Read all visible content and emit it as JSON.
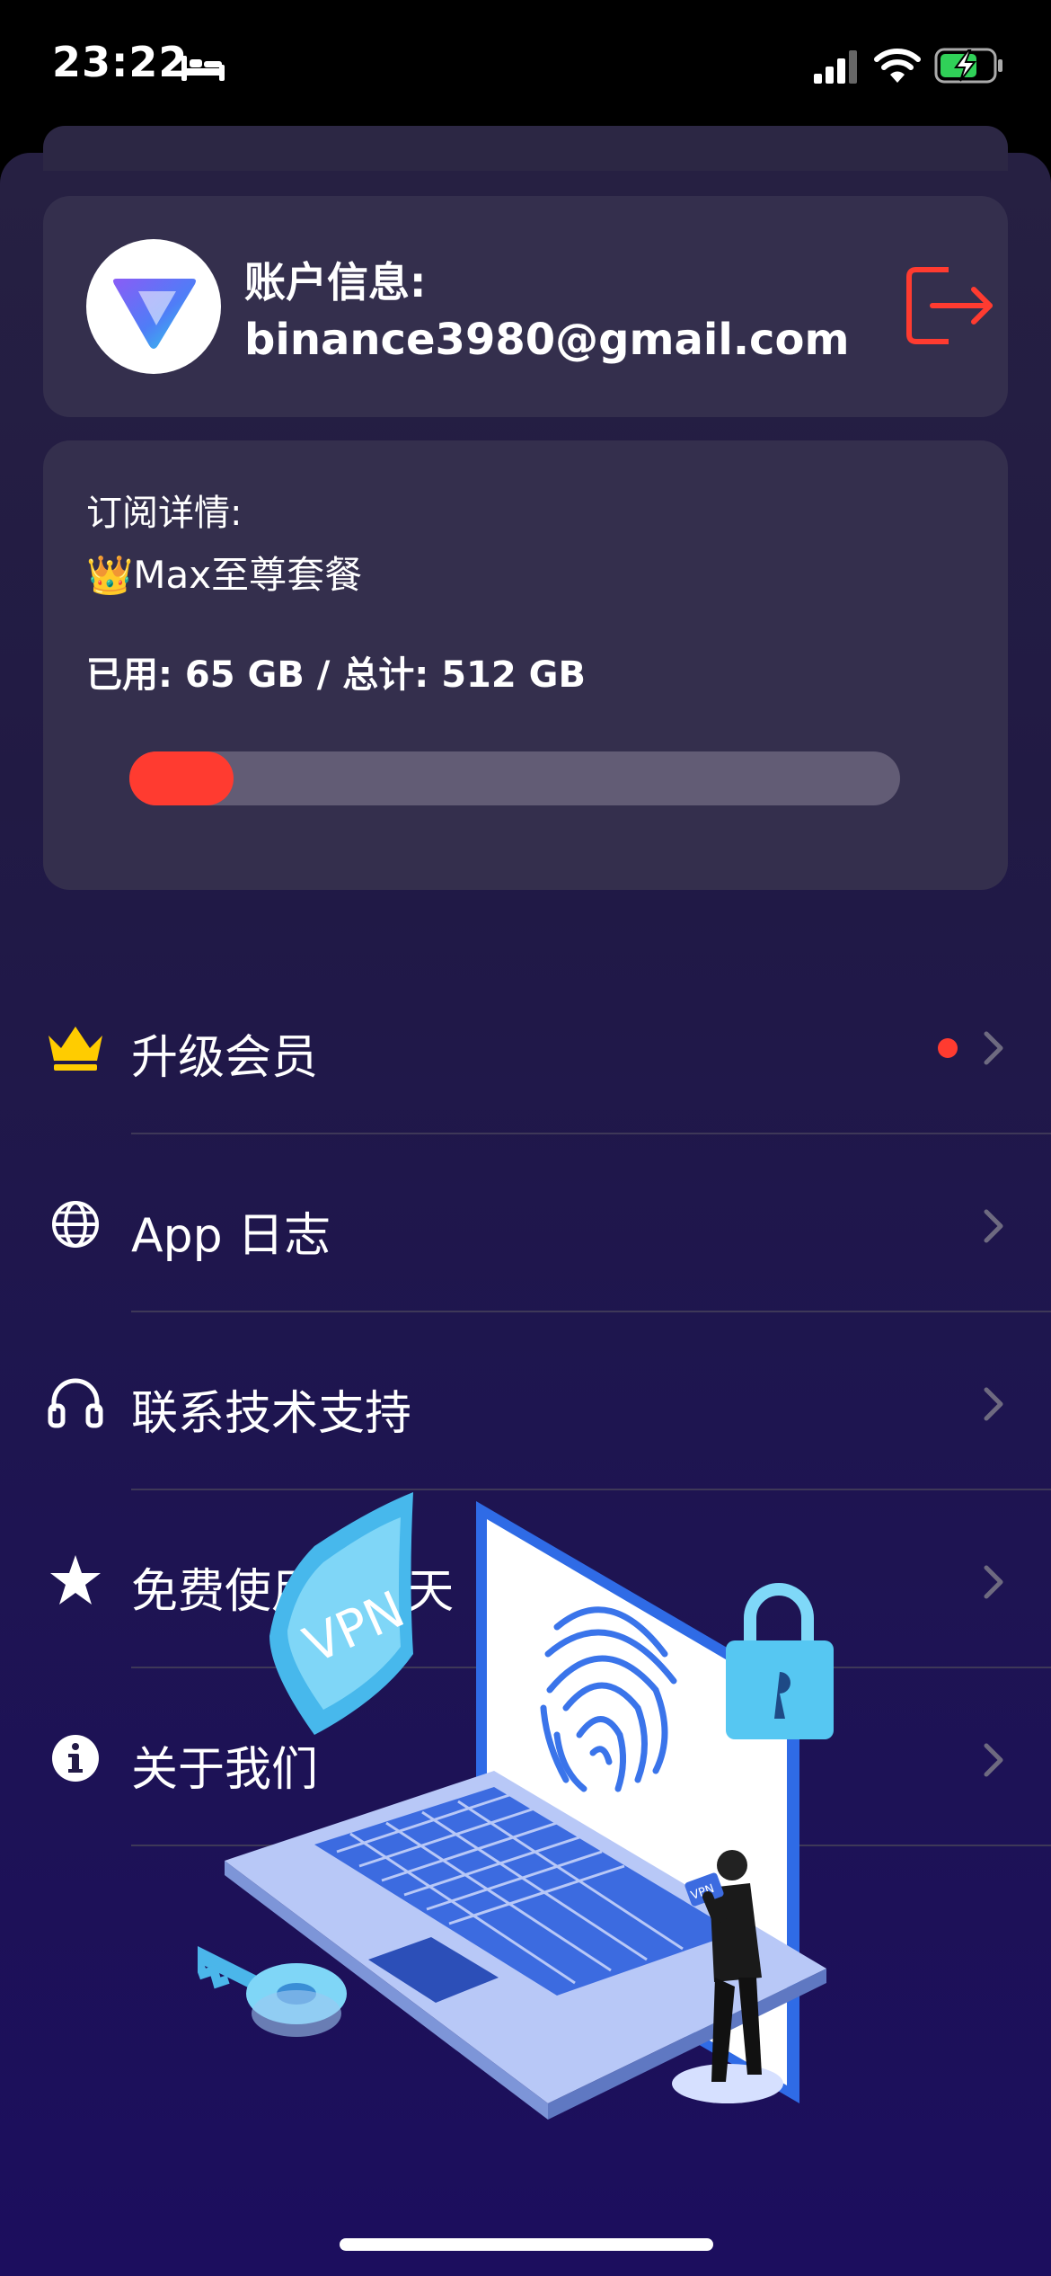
{
  "status_bar": {
    "time": "23:22",
    "icons": [
      "bed-icon",
      "signal-icon",
      "wifi-icon",
      "battery-charging-icon"
    ]
  },
  "account": {
    "title": "账户信息:",
    "email": "binance3980@gmail.com",
    "logo_icon": "app-logo-icon",
    "logout_icon": "logout-icon"
  },
  "subscription": {
    "title": "订阅详情:",
    "plan": "👑Max至尊套餐",
    "usage": "已用: 65 GB / 总计:  512 GB",
    "used_gb": 65,
    "total_gb": 512,
    "accent_color": "#ff3b30"
  },
  "menu": {
    "items": [
      {
        "label": "升级会员",
        "icon": "crown-icon",
        "badge": true
      },
      {
        "label": "App 日志",
        "icon": "globe-icon",
        "badge": false
      },
      {
        "label": "联系技术支持",
        "icon": "headphones-icon",
        "badge": false
      },
      {
        "label": "免费使用 30 天",
        "icon": "star-icon",
        "badge": false
      },
      {
        "label": "关于我们",
        "icon": "info-icon",
        "badge": false
      }
    ]
  },
  "illustration": {
    "shield_text": "VPN",
    "phone_text": "VPN"
  }
}
